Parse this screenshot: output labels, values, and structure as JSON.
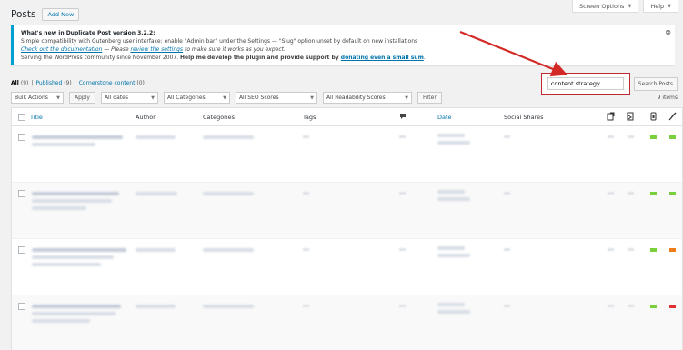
{
  "page": {
    "title": "Posts",
    "add_new": "Add New"
  },
  "top_tabs": {
    "screen_options": "Screen Options",
    "help": "Help"
  },
  "notice": {
    "heading": "What's new in Duplicate Post version 3.2.2:",
    "line1": "Simple compatibility with Gutenberg user interface: enable \"Admin bar\" under the Settings — \"Slug\" option unset by default on new installations",
    "link_documentation": "Check out the documentation",
    "sep": " — Please ",
    "link_review": "review the settings",
    "line2_end": " to make sure it works as you expect.",
    "line3_start": "Serving the WordPress community since November 2007. ",
    "line3_strong": "Help me develop the plugin and provide support by ",
    "link_donate": "donating even a small sum",
    "line3_end": ".",
    "close": "⊗"
  },
  "views": {
    "all_label": "All",
    "all_count": "(9)",
    "published_label": "Published",
    "published_count": "(9)",
    "cornerstone_label": "Cornerstone content",
    "cornerstone_count": "(0)",
    "sep": "|"
  },
  "search": {
    "value": "content strategy",
    "button": "Search Posts"
  },
  "filters": {
    "bulk_actions": "Bulk Actions",
    "apply": "Apply",
    "all_dates": "All dates",
    "all_categories": "All Categories",
    "all_seo": "All SEO Scores",
    "all_readability": "All Readability Scores",
    "filter": "Filter",
    "items": "9 items"
  },
  "columns": {
    "title": "Title",
    "author": "Author",
    "categories": "Categories",
    "tags": "Tags",
    "date": "Date",
    "social_shares": "Social Shares"
  },
  "icons": [
    "comment-icon",
    "outgoing-links-icon",
    "incoming-links-icon",
    "seo-score-icon",
    "readability-icon"
  ],
  "colors": {
    "accent": "#0073aa",
    "highlight": "#c0292d",
    "seo_good": "#7ad03a",
    "readability_ok": "#ee7c1b",
    "readability_bad": "#dc3232"
  },
  "rows": [
    {
      "seo": "#7ad03a",
      "readability": "#7ad03a"
    },
    {
      "seo": "#7ad03a",
      "readability": "#7ad03a"
    },
    {
      "seo": "#7ad03a",
      "readability": "#ee7c1b"
    },
    {
      "seo": "#7ad03a",
      "readability": "#dc3232"
    }
  ]
}
